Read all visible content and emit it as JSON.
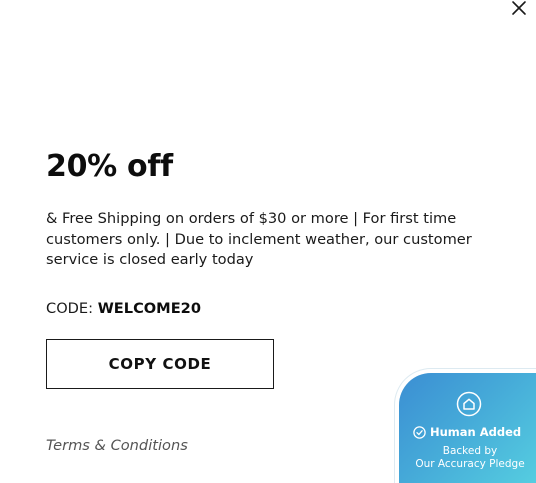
{
  "modal": {
    "headline": "20% off",
    "description": "& Free Shipping on orders of $30 or more | For first time customers only. | Due to inclement weather, our customer service is closed early today",
    "code_label": "CODE:",
    "code_value": "WELCOME20",
    "copy_button_label": "COPY CODE",
    "terms_link": "Terms & Conditions",
    "close_icon": "close-icon"
  },
  "badge": {
    "icon": "house-icon",
    "check_icon": "check-circle-icon",
    "title": "Human Added",
    "subtitle_line1": "Backed by",
    "subtitle_line2": "Our Accuracy Pledge",
    "gradient_start": "#3b8ed3",
    "gradient_end": "#55cde0"
  },
  "colors": {
    "text": "#111111",
    "muted_link": "#555555",
    "background": "#ffffff"
  }
}
